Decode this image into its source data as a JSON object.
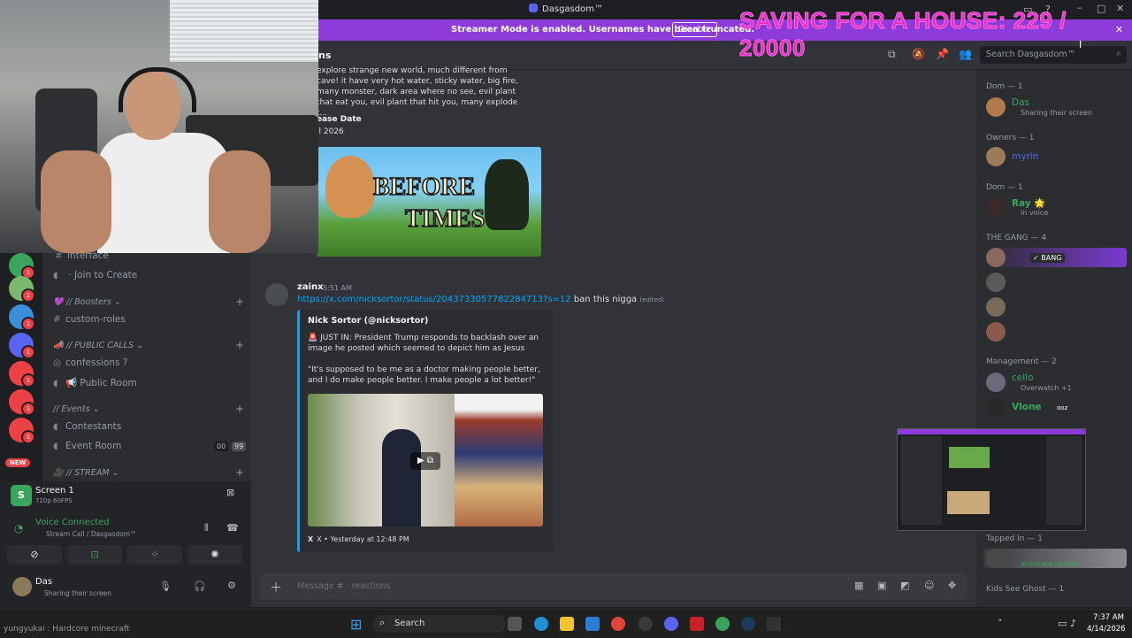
{
  "window": {
    "title": "Dasgasdom™"
  },
  "banner": {
    "text": "Streamer Mode is enabled. Usernames have been truncated.",
    "button": "Disable"
  },
  "overlay": {
    "text": "SAVING FOR A HOUSE: 229 / 20000"
  },
  "header": {
    "channel_fragment": "ns",
    "search_placeholder": "Search Dasgasdom™"
  },
  "game_post": {
    "desc": "explore strange new world, much different from cave! it have very hot water, sticky water, big fire, many monster, dark area where no see, evil plant that eat you, evil plant that hit you, many explode t...",
    "release_label": "ease Date",
    "release_value": "il 2026",
    "image_text_1": "BEFORE",
    "image_text_2": "TIMES"
  },
  "message": {
    "author": "zainx",
    "time": "5:51 AM",
    "link": "https://x.com/nicksortor/status/2043733057782284713?s=12",
    "text": "ban this nigga",
    "edited": "(edited)",
    "embed_author": "Nick Sortor (@nicksortor)",
    "embed_line1": "🚨 JUST IN: President Trump responds to backlash over an image he posted which seemed to depict him as Jesus",
    "embed_line2": "\"It's supposed to be me as a doctor making people better, and I do make people better. I make people a lot better!\"",
    "embed_footer": "X • Yesterday at 12:48 PM",
    "embed_footer_icon": "X"
  },
  "composer": {
    "placeholder": "Message # · reactions"
  },
  "sidebar": {
    "channels": [
      {
        "icon": "hash",
        "label": "interface"
      },
      {
        "icon": "speaker",
        "label": "Join to Create"
      }
    ],
    "boosters_cat": "💜 // Boosters",
    "custom_roles": "custom-roles",
    "public_cat": "// PUBLIC CALLS",
    "confessions": "confessions ?",
    "public_room": "Public Room",
    "events_cat": "// Events",
    "contestants": "Contestants",
    "event_room": "Event Room",
    "event_room_counts": [
      "00",
      "99"
    ],
    "stream_cat": "// STREAM"
  },
  "rail": {
    "new_label": "NEW",
    "badge": "1"
  },
  "voice": {
    "screen_title": "Screen 1",
    "screen_sub": "720p 60FPS",
    "status": "Voice Connected",
    "channel": "Stream Call / Dasgasdom™"
  },
  "user": {
    "name": "Das",
    "status": "Sharing their screen"
  },
  "members": {
    "groups": [
      {
        "header": "Dom — 1",
        "name": "Das",
        "sub": "Sharing their screen",
        "color": "#3ba55d"
      },
      {
        "header": "Owners — 1",
        "name": "myrin",
        "sub": "",
        "color": "#5865f2"
      },
      {
        "header": "Dom — 1",
        "name": "Ray 🌟",
        "sub": "In voice",
        "color": "#3ba55d"
      }
    ],
    "gang_header": "THE GANG — 4",
    "gang_tag": "BANG",
    "mgmt_header": "Management — 2",
    "mgmt": [
      {
        "name": "cello",
        "sub": "Overwatch +1",
        "color": "#3ba55d"
      },
      {
        "name": "Vlone",
        "sub": "ooz",
        "color": "#3ba55d"
      }
    ],
    "tapped_header": "Tapped In — 1",
    "tapped_sub": "jerkmate-ranked",
    "kids_header": "Kids See Ghost — 1"
  },
  "webcam_caption": "yungyukai : Hardcore minecraft",
  "taskbar": {
    "search": "Search",
    "time": "7:37 AM",
    "date": "4/14/2026"
  }
}
